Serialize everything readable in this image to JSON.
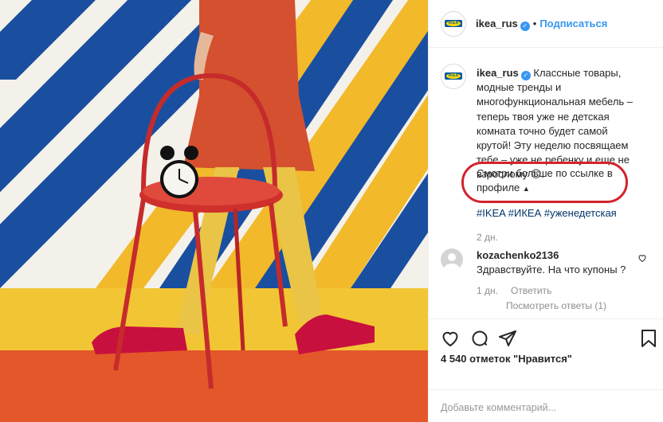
{
  "post": {
    "username": "ikea_rus",
    "follow_label": "Подписаться",
    "dot": "•",
    "caption": "Классные товары, модные тренды и многофункциональная мебель – теперь твоя уже не детская комната точно будет самой крутой! Эту неделю посвящаем тебе – уже не ребенку и еще не взрослому 😊.",
    "more": "Смотри больше по ссылке в профиле",
    "more_icon": "triangle-up-icon",
    "hashtags": "#IKEA #ИКЕА #уженедетская",
    "time": "2 дн."
  },
  "comment": {
    "username": "kozachenko2136",
    "text": "Здравствуйте. На что купоны ?",
    "time": "1 дн.",
    "reply_label": "Ответить",
    "view_replies": "Посмотреть ответы (1)"
  },
  "likes": "4 540 отметок \"Нравится\"",
  "comment_input": {
    "placeholder": "Добавьте комментарий..."
  },
  "colors": {
    "accent": "#3897f0",
    "highlight": "#d3232b"
  }
}
